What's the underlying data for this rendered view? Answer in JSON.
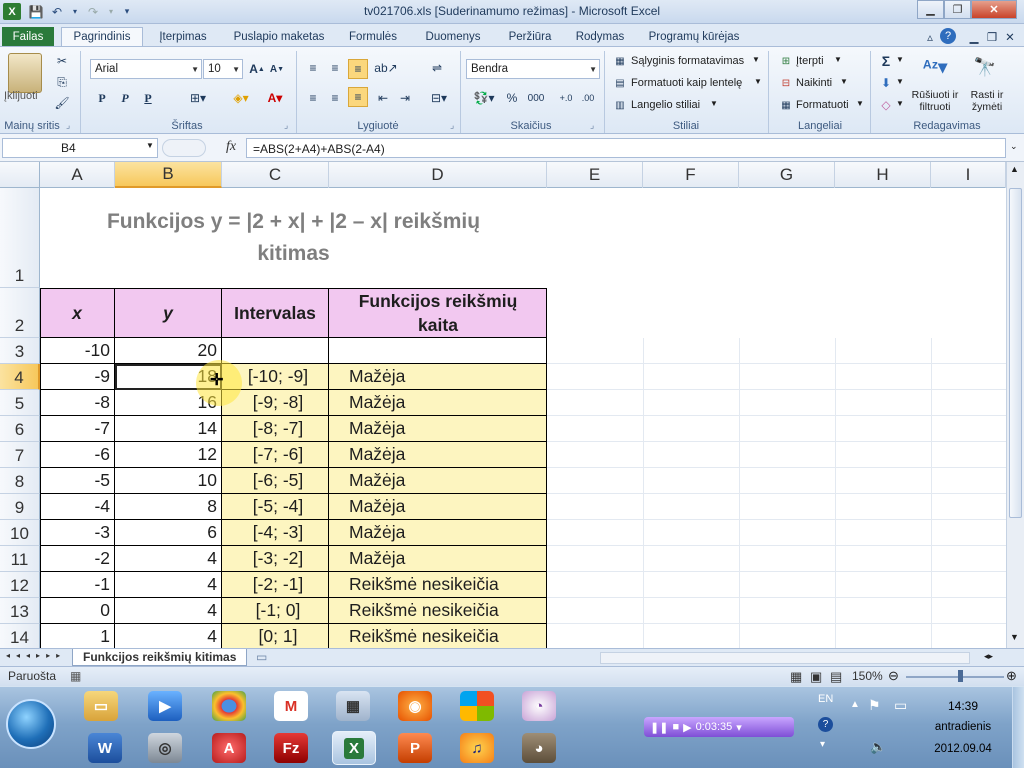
{
  "window": {
    "title": "tv021706.xls  [Suderinamumo režimas] - Microsoft Excel"
  },
  "ribbon": {
    "tabs": [
      "Failas",
      "Pagrindinis",
      "Įterpimas",
      "Puslapio maketas",
      "Formulės",
      "Duomenys",
      "Peržiūra",
      "Rodymas",
      "Programų kūrėjas"
    ],
    "active_tab": "Pagrindinis",
    "clipboard": {
      "paste": "Įklijuoti",
      "group": "Mainų sritis"
    },
    "font": {
      "name": "Arial",
      "size": "10",
      "bold": "P",
      "italic": "P",
      "underline": "P",
      "group": "Šriftas"
    },
    "alignment": {
      "group": "Lygiuotė"
    },
    "number": {
      "format": "Bendra",
      "percent": "%",
      "thousands": "000",
      "group": "Skaičius"
    },
    "styles": {
      "conditional": "Sąlyginis formatavimas",
      "as_table": "Formatuoti kaip lentelę",
      "cell_styles": "Langelio stiliai",
      "group": "Stiliai"
    },
    "cells": {
      "insert": "Įterpti",
      "delete": "Naikinti",
      "format": "Formatuoti",
      "group": "Langeliai"
    },
    "editing": {
      "sum": "Σ",
      "sort": "Rūšiuoti ir filtruoti",
      "find": "Rasti ir žymėti",
      "group": "Redagavimas"
    }
  },
  "formula_bar": {
    "name_box": "B4",
    "fx": "fx",
    "formula": "=ABS(2+A4)+ABS(2-A4)"
  },
  "columns": [
    "A",
    "B",
    "C",
    "D",
    "E",
    "F",
    "G",
    "H",
    "I"
  ],
  "sheet": {
    "title_line1": "Funkcijos  y = |2 + x| + |2 – x| reikšmių",
    "title_line2": "kitimas",
    "headers": [
      "x",
      "y",
      "Intervalas",
      "Funkcijos reikšmių kaita"
    ],
    "row_numbers": [
      "1",
      "2",
      "3",
      "4",
      "5",
      "6",
      "7",
      "8",
      "9",
      "10",
      "11",
      "12",
      "13",
      "14"
    ],
    "rows": [
      {
        "x": "-10",
        "y": "20",
        "interval": "",
        "trend": ""
      },
      {
        "x": "-9",
        "y": "18",
        "interval": "[-10; -9]",
        "trend": "Mažėja"
      },
      {
        "x": "-8",
        "y": "16",
        "interval": "[-9; -8]",
        "trend": "Mažėja"
      },
      {
        "x": "-7",
        "y": "14",
        "interval": "[-8; -7]",
        "trend": "Mažėja"
      },
      {
        "x": "-6",
        "y": "12",
        "interval": "[-7; -6]",
        "trend": "Mažėja"
      },
      {
        "x": "-5",
        "y": "10",
        "interval": "[-6; -5]",
        "trend": "Mažėja"
      },
      {
        "x": "-4",
        "y": "8",
        "interval": "[-5; -4]",
        "trend": "Mažėja"
      },
      {
        "x": "-3",
        "y": "6",
        "interval": "[-4; -3]",
        "trend": "Mažėja"
      },
      {
        "x": "-2",
        "y": "4",
        "interval": "[-3; -2]",
        "trend": "Mažėja"
      },
      {
        "x": "-1",
        "y": "4",
        "interval": "[-2; -1]",
        "trend": "Reikšmė nesikeičia"
      },
      {
        "x": "0",
        "y": "4",
        "interval": "[-1; 0]",
        "trend": "Reikšmė nesikeičia"
      },
      {
        "x": "1",
        "y": "4",
        "interval": "[0; 1]",
        "trend": "Reikšmė nesikeičia"
      }
    ],
    "tab_name": "Funkcijos reikšmių kitimas"
  },
  "status": {
    "ready": "Paruošta",
    "zoom": "150%"
  },
  "taskbar": {
    "lang": "EN",
    "time": "14:39",
    "day": "antradienis",
    "date": "2012.09.04",
    "recorder_time": "0:03:35"
  },
  "colors": {
    "title_text": "#7f7f7f",
    "header_fill": "#f2c8f0",
    "body_fill": "#fdf5c0",
    "selected_col": "#f7d86a"
  }
}
